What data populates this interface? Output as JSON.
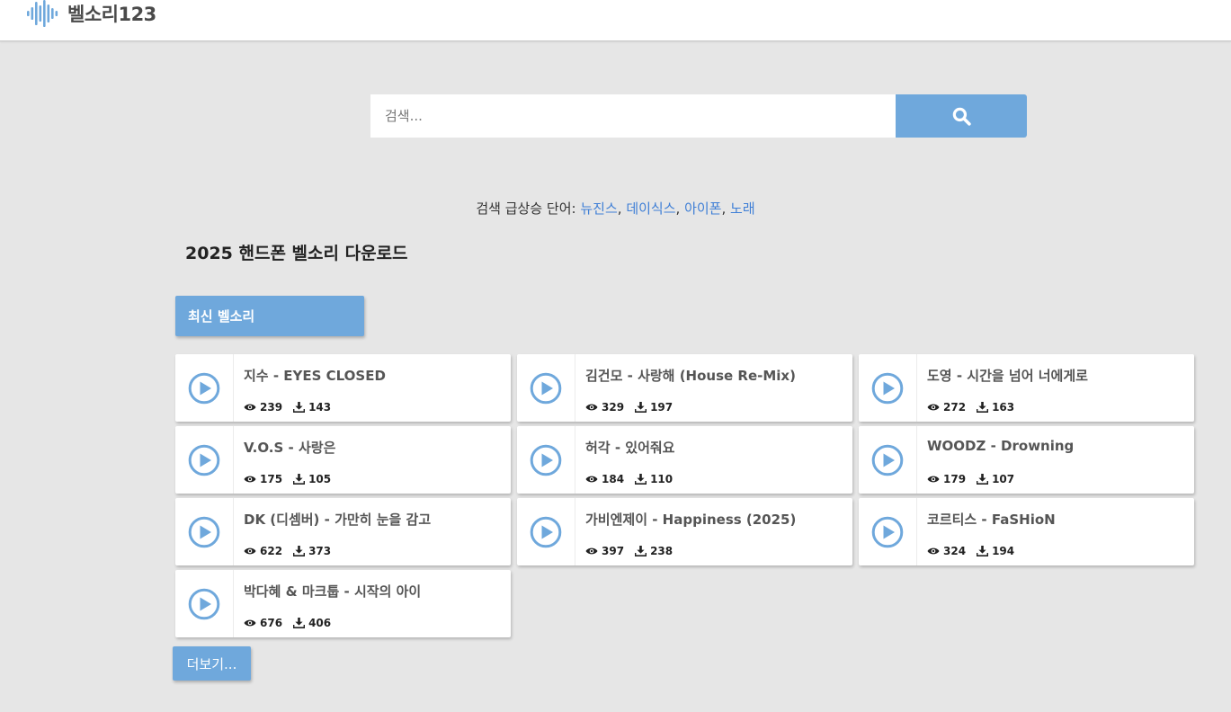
{
  "header": {
    "logo_text": "벨소리123",
    "logo_icon": "sound-wave-icon"
  },
  "search": {
    "placeholder": "검색...",
    "value": "",
    "button_icon": "search-icon"
  },
  "trending": {
    "label": "검색 급상승 단어:",
    "terms": [
      "뉴진스",
      "데이식스",
      "아이폰",
      "노래"
    ]
  },
  "page_title": "2025 핸드폰 벨소리 다운로드",
  "tab_latest": "최신 벨소리",
  "songs": [
    {
      "title": "지수 - EYES CLOSED",
      "views": "239",
      "downloads": "143"
    },
    {
      "title": "김건모 - 사랑해 (House Re-Mix)",
      "views": "329",
      "downloads": "197"
    },
    {
      "title": "도영 - 시간을 넘어 너에게로",
      "views": "272",
      "downloads": "163"
    },
    {
      "title": "V.O.S - 사랑은",
      "views": "175",
      "downloads": "105"
    },
    {
      "title": "허각 - 있어줘요",
      "views": "184",
      "downloads": "110"
    },
    {
      "title": "WOODZ - Drowning",
      "views": "179",
      "downloads": "107"
    },
    {
      "title": "DK (디셈버) - 가만히 눈을 감고",
      "views": "622",
      "downloads": "373"
    },
    {
      "title": "가비엔제이 - Happiness (2025)",
      "views": "397",
      "downloads": "238"
    },
    {
      "title": "코르티스 - FaSHioN",
      "views": "324",
      "downloads": "194"
    },
    {
      "title": "박다혜 & 마크툽 - 시작의 아이",
      "views": "676",
      "downloads": "406"
    }
  ],
  "more_button": "더보기...",
  "colors": {
    "accent": "#6fa8dc",
    "link": "#3f7fd6",
    "background": "#e6e6e6"
  }
}
